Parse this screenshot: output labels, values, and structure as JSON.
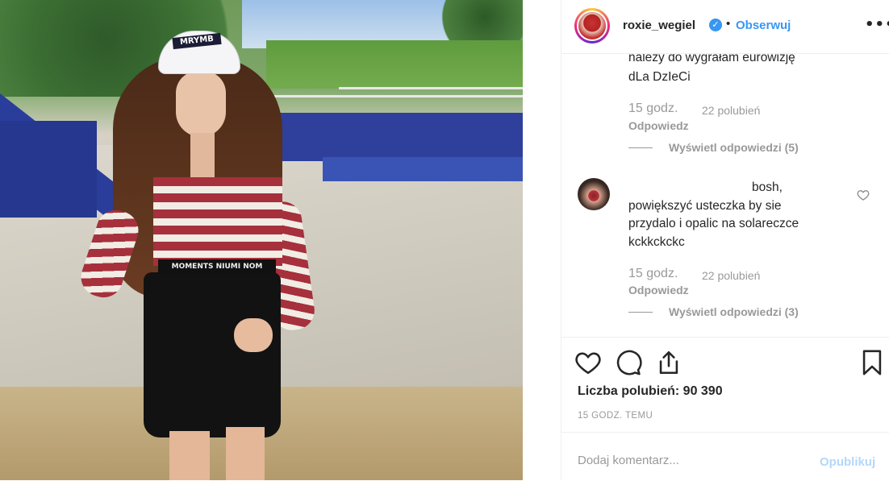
{
  "header": {
    "username": "roxie_wegiel",
    "separator": "•",
    "follow_label": "Obserwuj",
    "more_label": "•••"
  },
  "comments": [
    {
      "text_lines": [
        "należy do wygrałam eurowizję",
        "dLa DzIeCi"
      ],
      "time": "15 godz.",
      "likes": "22 polubień",
      "reply_label": "Odpowiedz",
      "view_replies": "Wyświetl odpowiedzi (5)"
    },
    {
      "text_lines": [
        "bosh,",
        "powiększyć usteczka by sie",
        "przydalo i opalic na solareczce",
        "kckkckckc"
      ],
      "time": "15 godz.",
      "likes": "22 polubień",
      "reply_label": "Odpowiedz",
      "view_replies": "Wyświetl odpowiedzi (3)"
    }
  ],
  "photo": {
    "cap_text": "MRYMB",
    "band_text": "MOMENTS NIUMI NOM"
  },
  "actions": {
    "icons": [
      "heart-icon",
      "comment-icon",
      "share-icon",
      "bookmark-icon"
    ]
  },
  "likes_label": "Liczba polubień: 90 390",
  "posted_time": "15 GODZ. TEMU",
  "add_comment": {
    "placeholder": "Dodaj komentarz...",
    "publish_label": "Opublikuj"
  },
  "colors": {
    "link_blue": "#3897f0",
    "publish_disabled": "#b3d7fb",
    "muted": "#999999",
    "text": "#262626"
  }
}
